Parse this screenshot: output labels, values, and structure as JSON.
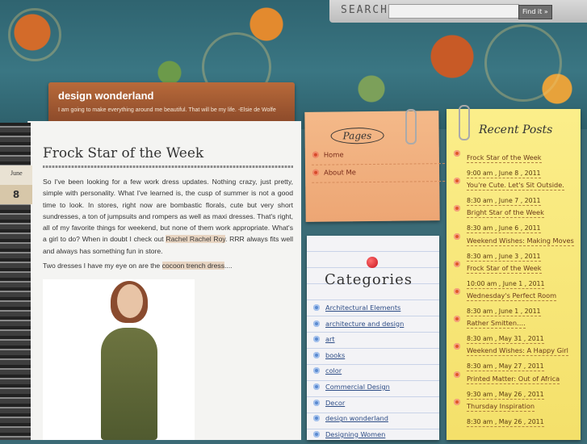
{
  "search": {
    "label": "SEARCH",
    "value": "",
    "button": "Find it »"
  },
  "site": {
    "title": "design wonderland",
    "tagline": "I am going to make everything around me beautiful. That will be my life. -Elsie de Wolfe"
  },
  "post": {
    "month": "June",
    "day": "8",
    "title": "Frock Star of the Week",
    "p1_text": "So I've been looking for a few work dress updates. Nothing crazy, just pretty, simple with personality. What I've learned is, the cusp of summer is not a good time to look. In stores, right now are bombastic florals, cute but very short sundresses, a ton of jumpsuits and rompers as well as maxi dresses. That's right, all of my favorite things for weekend, but none of them work appropriate. What's a girl to do? When in doubt I check out ",
    "p1_link": "Rachel Rachel Roy",
    "p1_tail": ". RRR always fits well and always has something fun in store.",
    "p2_text": "Two dresses I have my eye on are the ",
    "p2_link": "cocoon trench dress",
    "p2_tail": "...."
  },
  "pages": {
    "heading": "Pages",
    "items": [
      "Home",
      "About Me"
    ]
  },
  "categories": {
    "heading": "Categories",
    "items": [
      "Architectural Elements",
      "architecture and design",
      "art",
      "books",
      "color",
      "Commercial Design",
      "Decor",
      "design wonderland",
      "Designing Women"
    ]
  },
  "recent": {
    "heading": "Recent Posts",
    "items": [
      {
        "title": "Frock Star of the Week",
        "date": "9:00 am , June 8 , 2011"
      },
      {
        "title": "You're Cute. Let's Sit Outside.",
        "date": "8:30 am , June 7 , 2011"
      },
      {
        "title": "Bright Star of the Week",
        "date": "8:30 am , June 6 , 2011"
      },
      {
        "title": "Weekend Wishes: Making Moves",
        "date": "8:30 am , June 3 , 2011"
      },
      {
        "title": "Frock Star of the Week",
        "date": "10:00 am , June 1 , 2011"
      },
      {
        "title": "Wednesday's Perfect Room",
        "date": "8:30 am , June 1 , 2011"
      },
      {
        "title": "Rather Smitten….",
        "date": "8:30 am , May 31 , 2011"
      },
      {
        "title": "Weekend Wishes: A Happy Girl",
        "date": "8:30 am , May 27 , 2011"
      },
      {
        "title": "Printed Matter: Out of Africa",
        "date": "9:30 am , May 26 , 2011"
      },
      {
        "title": "Thursday Inspiration",
        "date": "8:30 am , May 26 , 2011"
      }
    ]
  },
  "colors": {
    "accent_orange": "#e0572a",
    "link_blue": "#2e4d86",
    "title_box": "#a85c33"
  }
}
